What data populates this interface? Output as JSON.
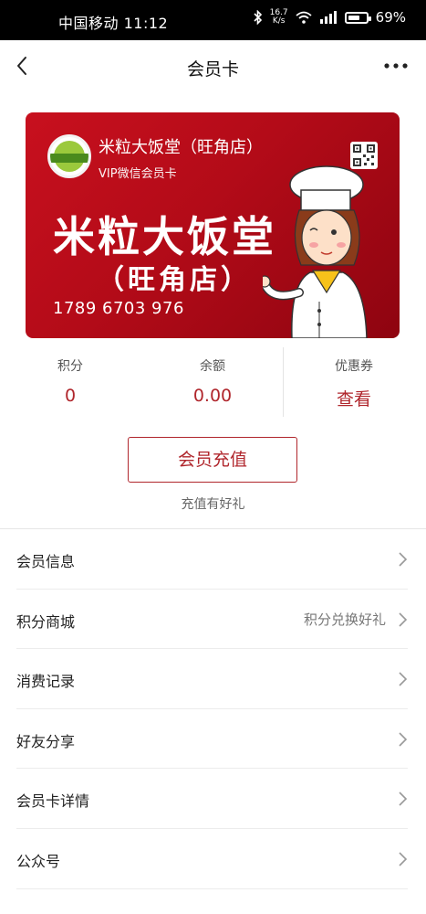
{
  "status_bar": {
    "carrier_time": "中国移动 11:12",
    "speed_top": "16.7",
    "speed_unit": "K/s",
    "battery": "69%",
    "battery_level": 0.69
  },
  "nav": {
    "title": "会员卡",
    "back_icon": "chevron-left-icon",
    "more_icon": "more-dots-icon"
  },
  "card": {
    "store_name": "米粒大饭堂（旺角店）",
    "card_type": "VIP微信会员卡",
    "big_title_line1": "米粒大饭堂",
    "big_title_line2": "（旺角店）",
    "card_number": "1789 6703 976",
    "background_color": "#c8101e",
    "qr_icon": "qr-code-icon"
  },
  "stats": [
    {
      "label": "积分",
      "value": "0"
    },
    {
      "label": "余额",
      "value": "0.00"
    },
    {
      "label": "优惠券",
      "value": "查看"
    }
  ],
  "recharge": {
    "button_label": "会员充值",
    "note": "充值有好礼",
    "accent_color": "#b0262c"
  },
  "menu": [
    {
      "label": "会员信息",
      "value": ""
    },
    {
      "label": "积分商城",
      "value": "积分兑换好礼"
    },
    {
      "label": "消费记录",
      "value": ""
    },
    {
      "label": "好友分享",
      "value": ""
    },
    {
      "label": "会员卡详情",
      "value": ""
    },
    {
      "label": "公众号",
      "value": ""
    }
  ]
}
